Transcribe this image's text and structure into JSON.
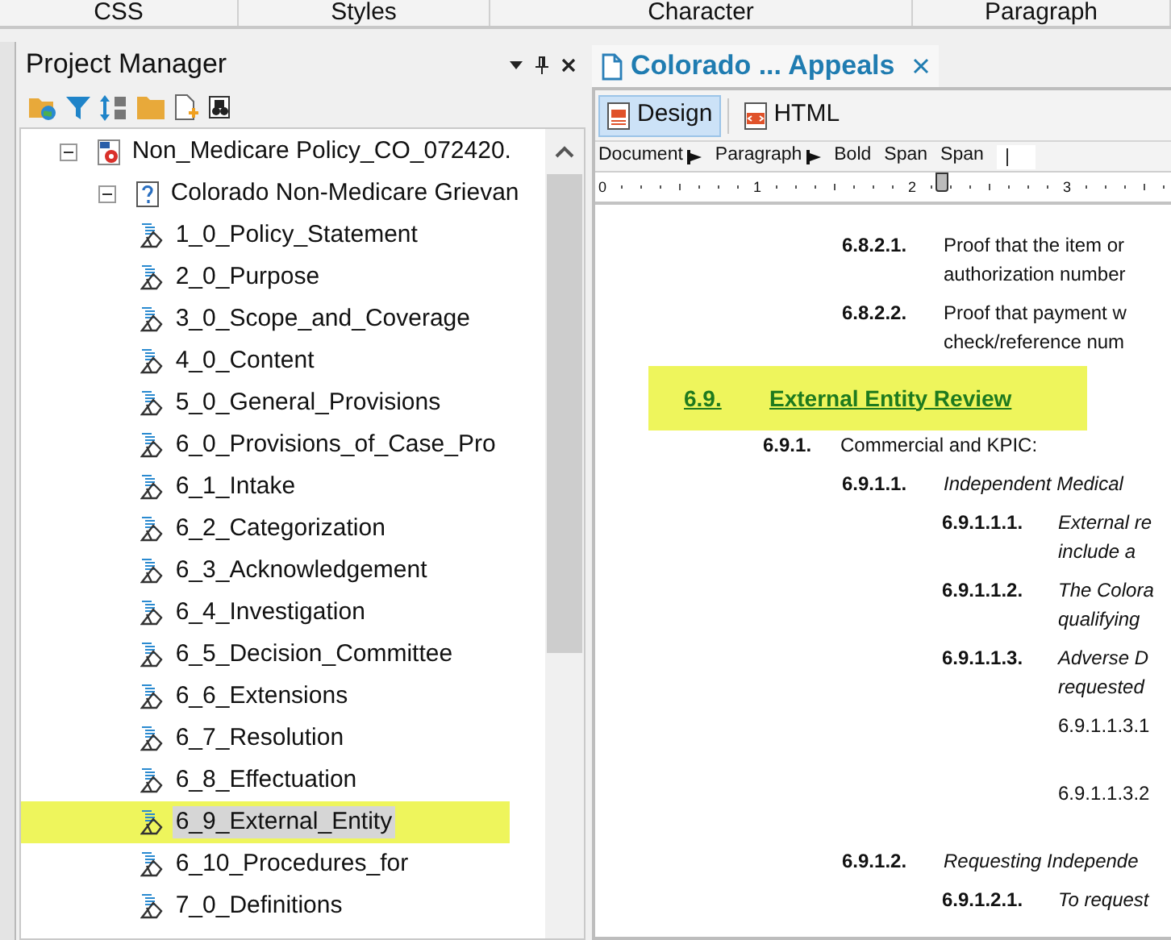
{
  "top_tabs": [
    {
      "label": "CSS"
    },
    {
      "label": "Styles"
    },
    {
      "label": "Character"
    },
    {
      "label": "Paragraph"
    }
  ],
  "project_manager": {
    "title": "Project Manager",
    "tree": [
      {
        "label": "Non_Medicare Policy_CO_072420.",
        "kind": "document",
        "expanded": true,
        "selected": false,
        "highlighted": false,
        "children": [
          {
            "label": "Colorado Non-Medicare Grievan",
            "kind": "page",
            "expanded": true,
            "selected": false,
            "highlighted": false,
            "children": [
              {
                "label": "1_0_Policy_Statement",
                "kind": "topic",
                "selected": false,
                "highlighted": false
              },
              {
                "label": "2_0_Purpose",
                "kind": "topic",
                "selected": false,
                "highlighted": false
              },
              {
                "label": "3_0_Scope_and_Coverage",
                "kind": "topic",
                "selected": false,
                "highlighted": false
              },
              {
                "label": "4_0_Content",
                "kind": "topic",
                "selected": false,
                "highlighted": false
              },
              {
                "label": "5_0_General_Provisions",
                "kind": "topic",
                "selected": false,
                "highlighted": false
              },
              {
                "label": "6_0_Provisions_of_Case_Pro",
                "kind": "topic",
                "selected": false,
                "highlighted": false
              },
              {
                "label": "6_1_Intake",
                "kind": "topic",
                "selected": false,
                "highlighted": false
              },
              {
                "label": "6_2_Categorization",
                "kind": "topic",
                "selected": false,
                "highlighted": false
              },
              {
                "label": "6_3_Acknowledgement",
                "kind": "topic",
                "selected": false,
                "highlighted": false
              },
              {
                "label": "6_4_Investigation",
                "kind": "topic",
                "selected": false,
                "highlighted": false
              },
              {
                "label": "6_5_Decision_Committee",
                "kind": "topic",
                "selected": false,
                "highlighted": false
              },
              {
                "label": "6_6_Extensions",
                "kind": "topic",
                "selected": false,
                "highlighted": false
              },
              {
                "label": "6_7_Resolution",
                "kind": "topic",
                "selected": false,
                "highlighted": false
              },
              {
                "label": "6_8_Effectuation",
                "kind": "topic",
                "selected": false,
                "highlighted": false
              },
              {
                "label": "6_9_External_Entity",
                "kind": "topic",
                "selected": true,
                "highlighted": true
              },
              {
                "label": "6_10_Procedures_for",
                "kind": "topic",
                "selected": false,
                "highlighted": false
              },
              {
                "label": "7_0_Definitions",
                "kind": "topic",
                "selected": false,
                "highlighted": false
              }
            ]
          }
        ]
      }
    ]
  },
  "editor": {
    "tab": {
      "title": "Colorado ... Appeals"
    },
    "views": [
      {
        "label": "Design",
        "selected": true
      },
      {
        "label": "HTML",
        "selected": false
      }
    ],
    "breadcrumb": [
      {
        "label": "Document",
        "arrow_after": true
      },
      {
        "label": "Paragraph",
        "arrow_after": true
      },
      {
        "label": "Bold",
        "arrow_after": false
      },
      {
        "label": "Span",
        "arrow_after": false
      },
      {
        "label": "Span",
        "arrow_after": false
      }
    ],
    "ruler": {
      "labels": [
        "0",
        "1",
        "2",
        "3"
      ],
      "level": 0.62
    },
    "document": [
      {
        "kind": "clause4",
        "number": "6.8.2.1.",
        "lines": [
          "Proof that the item or",
          "authorization number"
        ],
        "italic": false
      },
      {
        "kind": "clause4",
        "number": "6.8.2.2.",
        "lines": [
          "Proof that payment w",
          "check/reference num"
        ],
        "italic": false
      },
      {
        "kind": "heading",
        "number": "6.9.",
        "lines": [
          "External Entity Review"
        ],
        "highlighted": true
      },
      {
        "kind": "clause3",
        "number": "6.9.1.",
        "lines": [
          "Commercial and KPIC:"
        ],
        "italic": false
      },
      {
        "kind": "clause4",
        "number": "6.9.1.1.",
        "lines": [
          "Independent Medical"
        ],
        "italic": true
      },
      {
        "kind": "clause5",
        "number": "6.9.1.1.1.",
        "lines": [
          "External re",
          "include a"
        ],
        "italic": true
      },
      {
        "kind": "clause5",
        "number": "6.9.1.1.2.",
        "lines": [
          "The Colora",
          "qualifying"
        ],
        "italic": true
      },
      {
        "kind": "clause5",
        "number": "6.9.1.1.3.",
        "lines": [
          "Adverse D",
          "requested"
        ],
        "italic": true
      },
      {
        "kind": "clause6",
        "number": "6.9.1.1.3.1"
      },
      {
        "kind": "clause6",
        "number": "6.9.1.1.3.2"
      },
      {
        "kind": "clause4",
        "number": "6.9.1.2.",
        "lines": [
          "Requesting Independe"
        ],
        "italic": true
      },
      {
        "kind": "clause5",
        "number": "6.9.1.2.1.",
        "lines": [
          "To request"
        ],
        "italic": true
      }
    ]
  }
}
